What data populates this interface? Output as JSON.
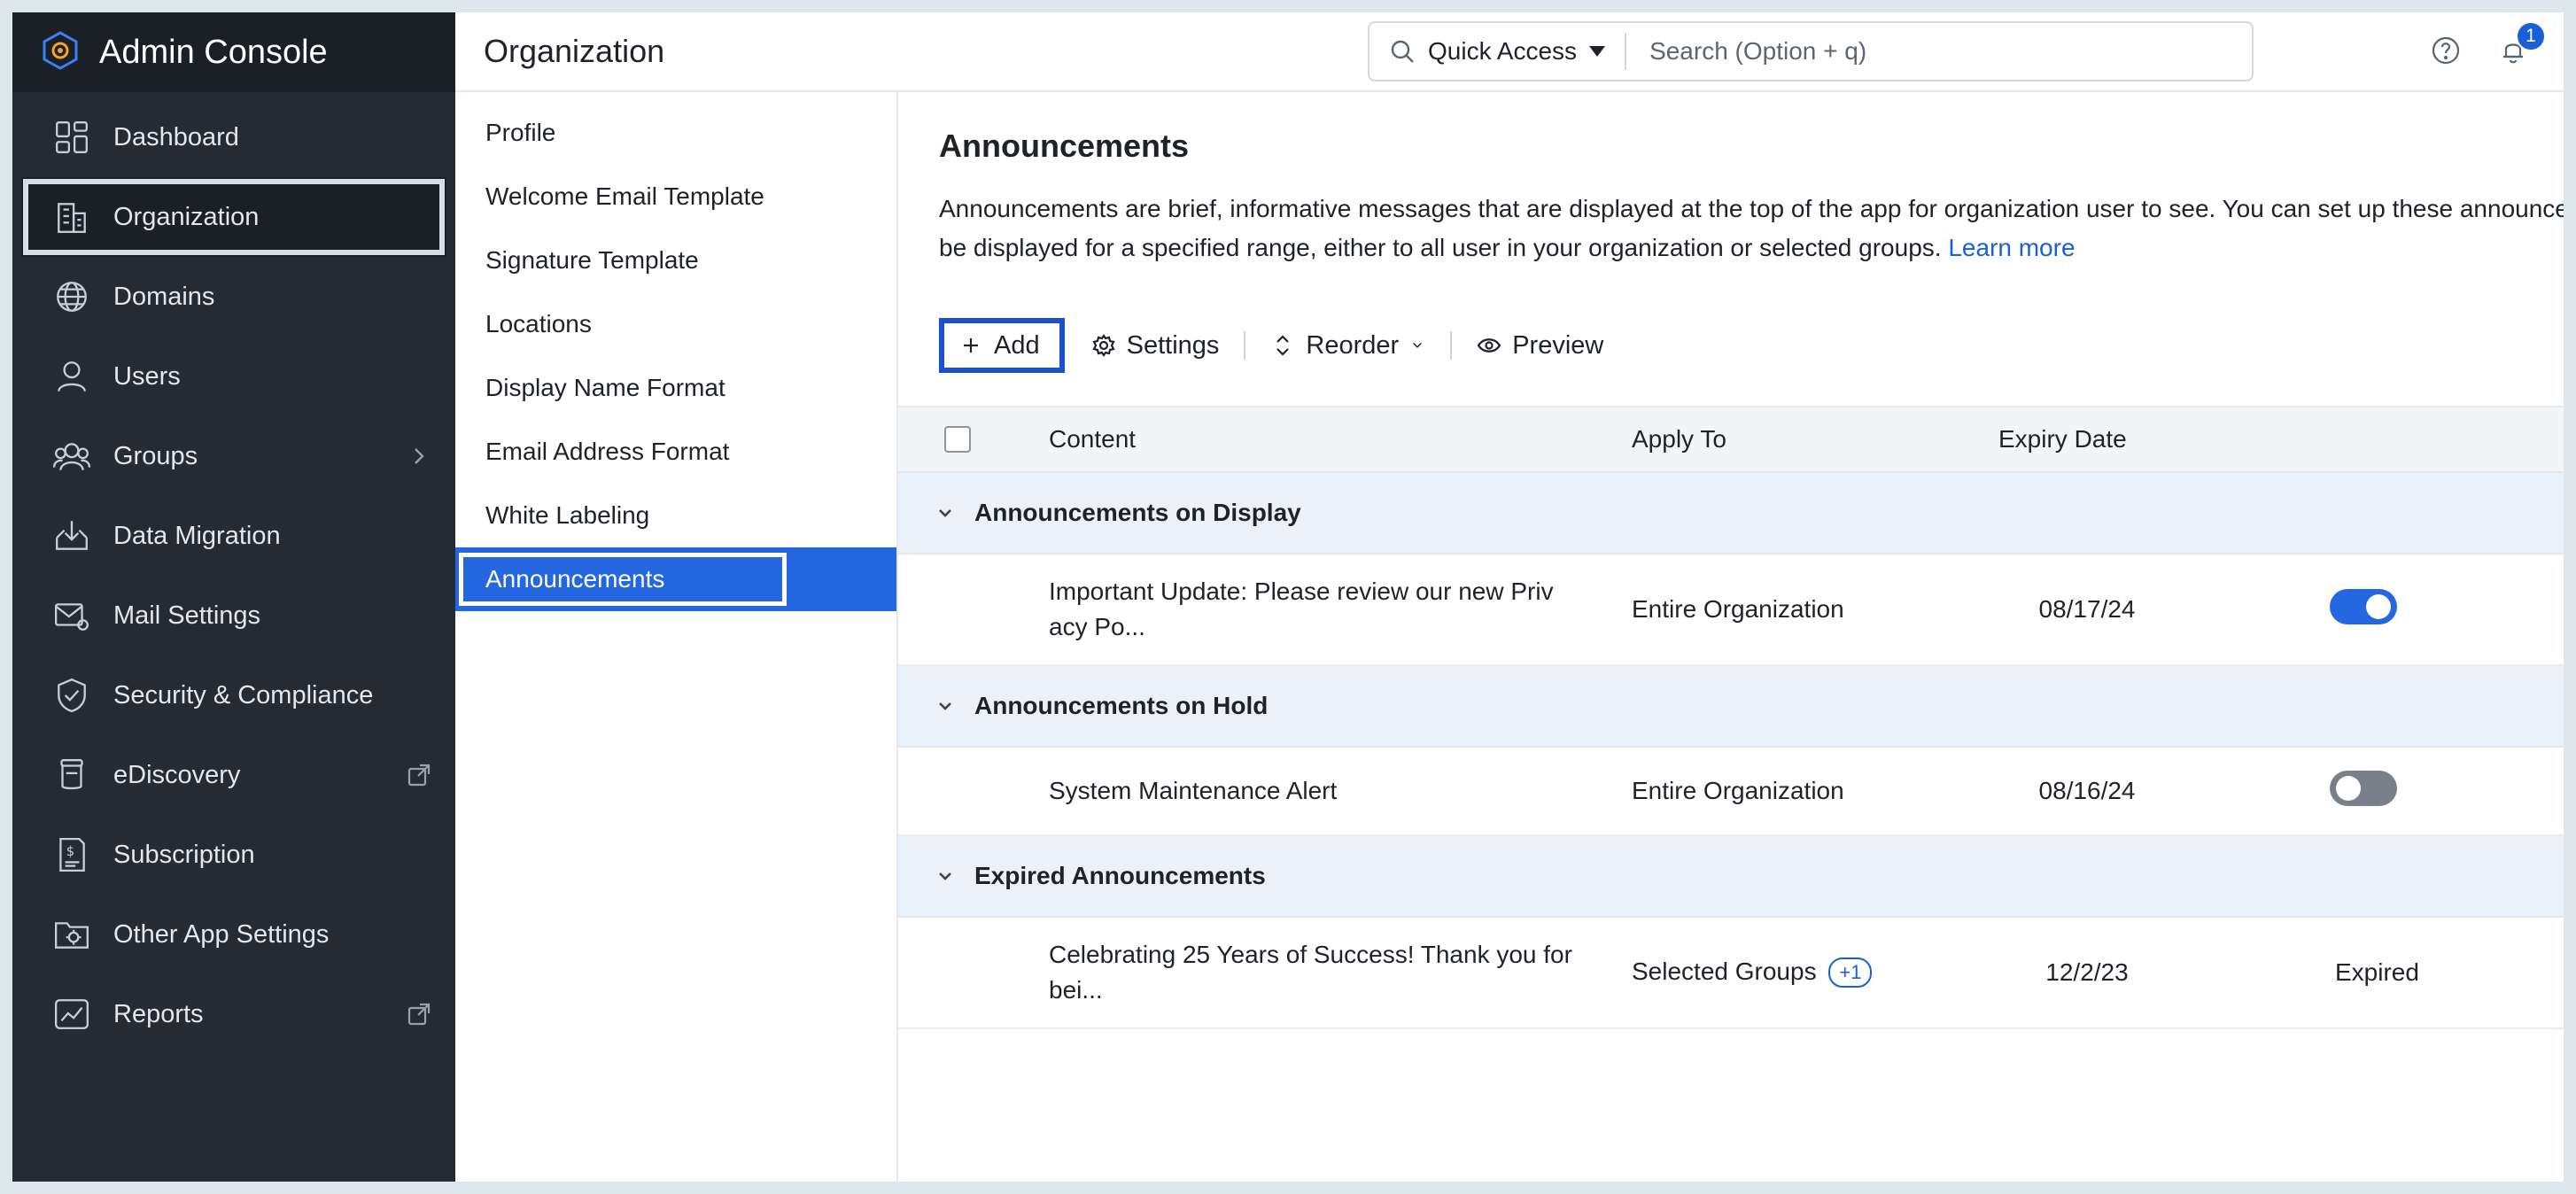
{
  "app": {
    "title": "Admin Console"
  },
  "sidebar": {
    "items": [
      {
        "label": "Dashboard"
      },
      {
        "label": "Organization"
      },
      {
        "label": "Domains"
      },
      {
        "label": "Users"
      },
      {
        "label": "Groups"
      },
      {
        "label": "Data Migration"
      },
      {
        "label": "Mail Settings"
      },
      {
        "label": "Security & Compliance"
      },
      {
        "label": "eDiscovery"
      },
      {
        "label": "Subscription"
      },
      {
        "label": "Other App Settings"
      },
      {
        "label": "Reports"
      }
    ]
  },
  "header": {
    "title": "Organization",
    "quick_access": "Quick Access",
    "search_placeholder": "Search (Option + q)",
    "notification_count": "1"
  },
  "subnav": {
    "items": [
      {
        "label": "Profile"
      },
      {
        "label": "Welcome Email Template"
      },
      {
        "label": "Signature Template"
      },
      {
        "label": "Locations"
      },
      {
        "label": "Display Name Format"
      },
      {
        "label": "Email Address Format"
      },
      {
        "label": "White Labeling"
      },
      {
        "label": "Announcements"
      }
    ]
  },
  "panel": {
    "title": "Announcements",
    "description": "Announcements are brief, informative messages that are displayed at the top of the app for organization user to see. You can set up these announcements to be displayed for a specified range, either to all user in your organization or selected groups.",
    "learn_more": "Learn more"
  },
  "toolbar": {
    "add": "Add",
    "settings": "Settings",
    "reorder": "Reorder",
    "preview": "Preview"
  },
  "table": {
    "headers": {
      "content": "Content",
      "apply_to": "Apply To",
      "expiry": "Expiry Date"
    },
    "groups": [
      {
        "title": "Announcements on Display",
        "rows": [
          {
            "content": "Important Update: Please review our new Priv acy Po...",
            "apply_to": "Entire Organization",
            "expiry": "08/17/24",
            "state": "on"
          }
        ]
      },
      {
        "title": "Announcements on Hold",
        "rows": [
          {
            "content": "System Maintenance Alert",
            "apply_to": "Entire Organization",
            "expiry": "08/16/24",
            "state": "off"
          }
        ]
      },
      {
        "title": "Expired Announcements",
        "rows": [
          {
            "content": "Celebrating 25 Years of Success! Thank you for bei...",
            "apply_to": "Selected Groups",
            "apply_extra": "+1",
            "expiry": "12/2/23",
            "state_text": "Expired"
          }
        ]
      }
    ]
  },
  "colors": {
    "sidebar_bg": "#252a33",
    "accent": "#2467e0",
    "link": "#1a5fd6",
    "group_row_bg": "#eaf1fb"
  }
}
